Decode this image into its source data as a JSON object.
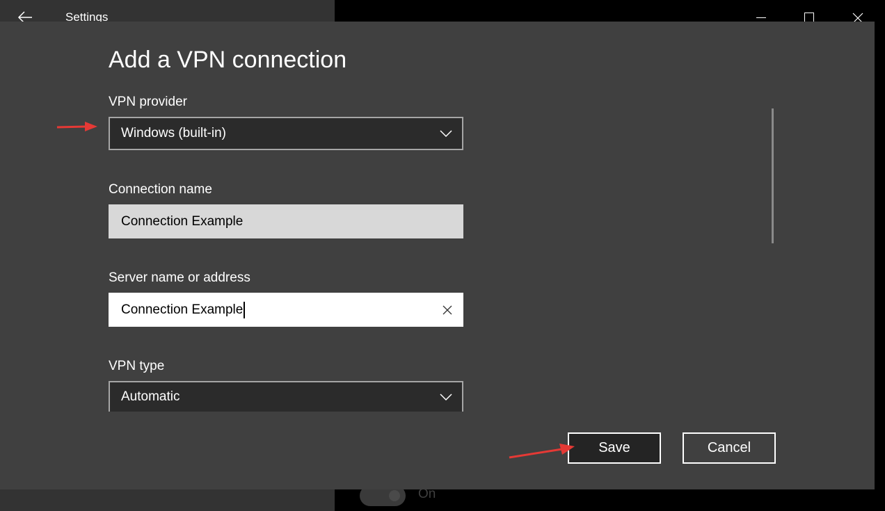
{
  "window": {
    "app_title": "Settings",
    "icons": {
      "back": "back-arrow-icon",
      "minimize": "minimize-icon",
      "maximize": "maximize-icon",
      "close": "close-icon"
    }
  },
  "dialog": {
    "title": "Add a VPN connection",
    "vpn_provider": {
      "label": "VPN provider",
      "value": "Windows (built-in)"
    },
    "connection_name": {
      "label": "Connection name",
      "value": "Connection Example"
    },
    "server": {
      "label": "Server name or address",
      "value": "Connection Example"
    },
    "vpn_type": {
      "label": "VPN type",
      "value": "Automatic"
    },
    "save_label": "Save",
    "cancel_label": "Cancel"
  },
  "background": {
    "toggle_label": "On"
  },
  "colors": {
    "dialog_bg": "#404040",
    "annotation_arrow": "#e53935",
    "input_bg": "#ffffff"
  }
}
